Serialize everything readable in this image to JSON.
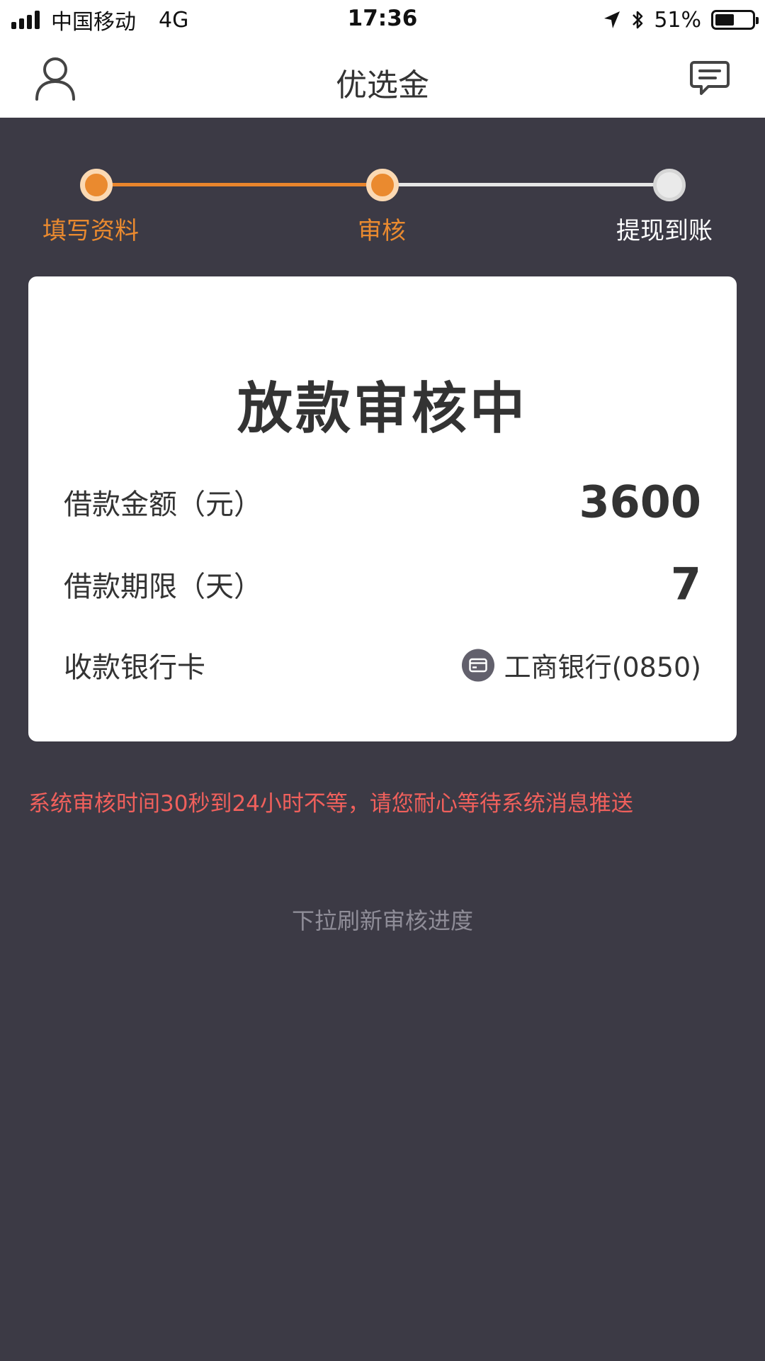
{
  "status_bar": {
    "carrier": "中国移动",
    "network": "4G",
    "time": "17:36",
    "battery": "51%",
    "battery_level": 0.51
  },
  "nav": {
    "title": "优选金",
    "left_icon": "user-icon",
    "right_icon": "message-icon"
  },
  "steps": [
    {
      "label": "填写资料",
      "state": "done"
    },
    {
      "label": "审核",
      "state": "current"
    },
    {
      "label": "提现到账",
      "state": "pending"
    }
  ],
  "colors": {
    "accent": "#ea8a2f",
    "background": "#3c3a45",
    "notice": "#f0605c"
  },
  "card": {
    "title": "放款审核中",
    "rows": [
      {
        "label": "借款金额（元）",
        "value": "3600"
      },
      {
        "label": "借款期限（天）",
        "value": "7"
      },
      {
        "label": "收款银行卡",
        "value": "工商银行(0850)",
        "icon": "bank-card-icon"
      }
    ]
  },
  "notice": "系统审核时间30秒到24小时不等，请您耐心等待系统消息推送",
  "pull_hint": "下拉刷新审核进度"
}
